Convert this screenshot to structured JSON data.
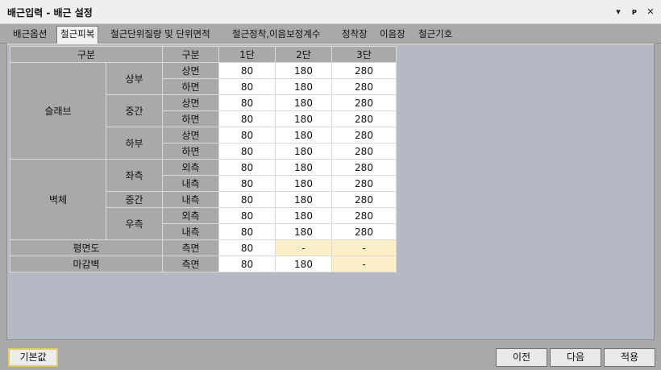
{
  "window": {
    "title": "배근입력 - 배근 설정"
  },
  "tabs": [
    {
      "label": "배근옵션"
    },
    {
      "label": "철근피복"
    },
    {
      "label": "철근단위질량 및 단위면적"
    },
    {
      "label": "철근정착,이음보정계수"
    },
    {
      "label": "정착장"
    },
    {
      "label": "이음장"
    },
    {
      "label": "철근기호"
    }
  ],
  "table": {
    "header": {
      "group": "구분",
      "subgroup": "구분",
      "cols": [
        "1단",
        "2단",
        "3단"
      ]
    },
    "groups": {
      "slab": "슬래브",
      "wall": "벽체",
      "plan": "평면도",
      "finish_wall": "마감벽"
    },
    "subgroups": {
      "top": "상부",
      "middle": "중간",
      "bottom": "하부",
      "left": "좌측",
      "wall_middle": "중간",
      "right": "우측"
    },
    "rows": [
      {
        "face": "상면",
        "values": [
          "80",
          "180",
          "280"
        ]
      },
      {
        "face": "하면",
        "values": [
          "80",
          "180",
          "280"
        ]
      },
      {
        "face": "상면",
        "values": [
          "80",
          "180",
          "280"
        ]
      },
      {
        "face": "하면",
        "values": [
          "80",
          "180",
          "280"
        ]
      },
      {
        "face": "상면",
        "values": [
          "80",
          "180",
          "280"
        ]
      },
      {
        "face": "하면",
        "values": [
          "80",
          "180",
          "280"
        ]
      },
      {
        "face": "외측",
        "values": [
          "80",
          "180",
          "280"
        ]
      },
      {
        "face": "내측",
        "values": [
          "80",
          "180",
          "280"
        ]
      },
      {
        "face": "내측",
        "values": [
          "80",
          "180",
          "280"
        ]
      },
      {
        "face": "외측",
        "values": [
          "80",
          "180",
          "280"
        ]
      },
      {
        "face": "내측",
        "values": [
          "80",
          "180",
          "280"
        ]
      },
      {
        "face": "측면",
        "values": [
          "80",
          "-",
          "-"
        ]
      },
      {
        "face": "측면",
        "values": [
          "80",
          "180",
          "-"
        ]
      }
    ]
  },
  "buttons": {
    "default": "기본값",
    "prev": "이전",
    "next": "다음",
    "apply": "적용"
  },
  "colors": {
    "panel": "#b4b9c4",
    "header_cell": "#a9a9a9",
    "disabled_cell": "#fcefc7",
    "default_button_border": "#e3cd6a"
  }
}
